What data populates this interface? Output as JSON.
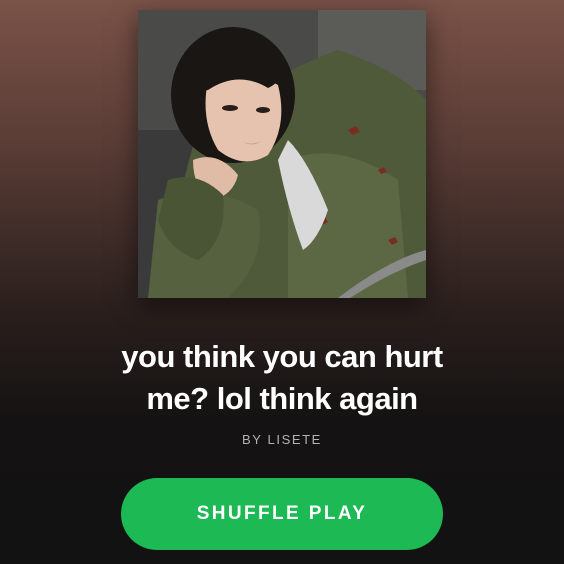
{
  "playlist": {
    "title_line1": "you think you can hurt",
    "title_line2": "me? lol think again",
    "byline": "BY LISETE"
  },
  "actions": {
    "shuffle_label": "SHUFFLE PLAY"
  },
  "colors": {
    "accent": "#1db954",
    "background_top": "#7a5248",
    "background_bottom": "#121212",
    "text_primary": "#ffffff",
    "text_secondary": "#b3b3b3"
  }
}
